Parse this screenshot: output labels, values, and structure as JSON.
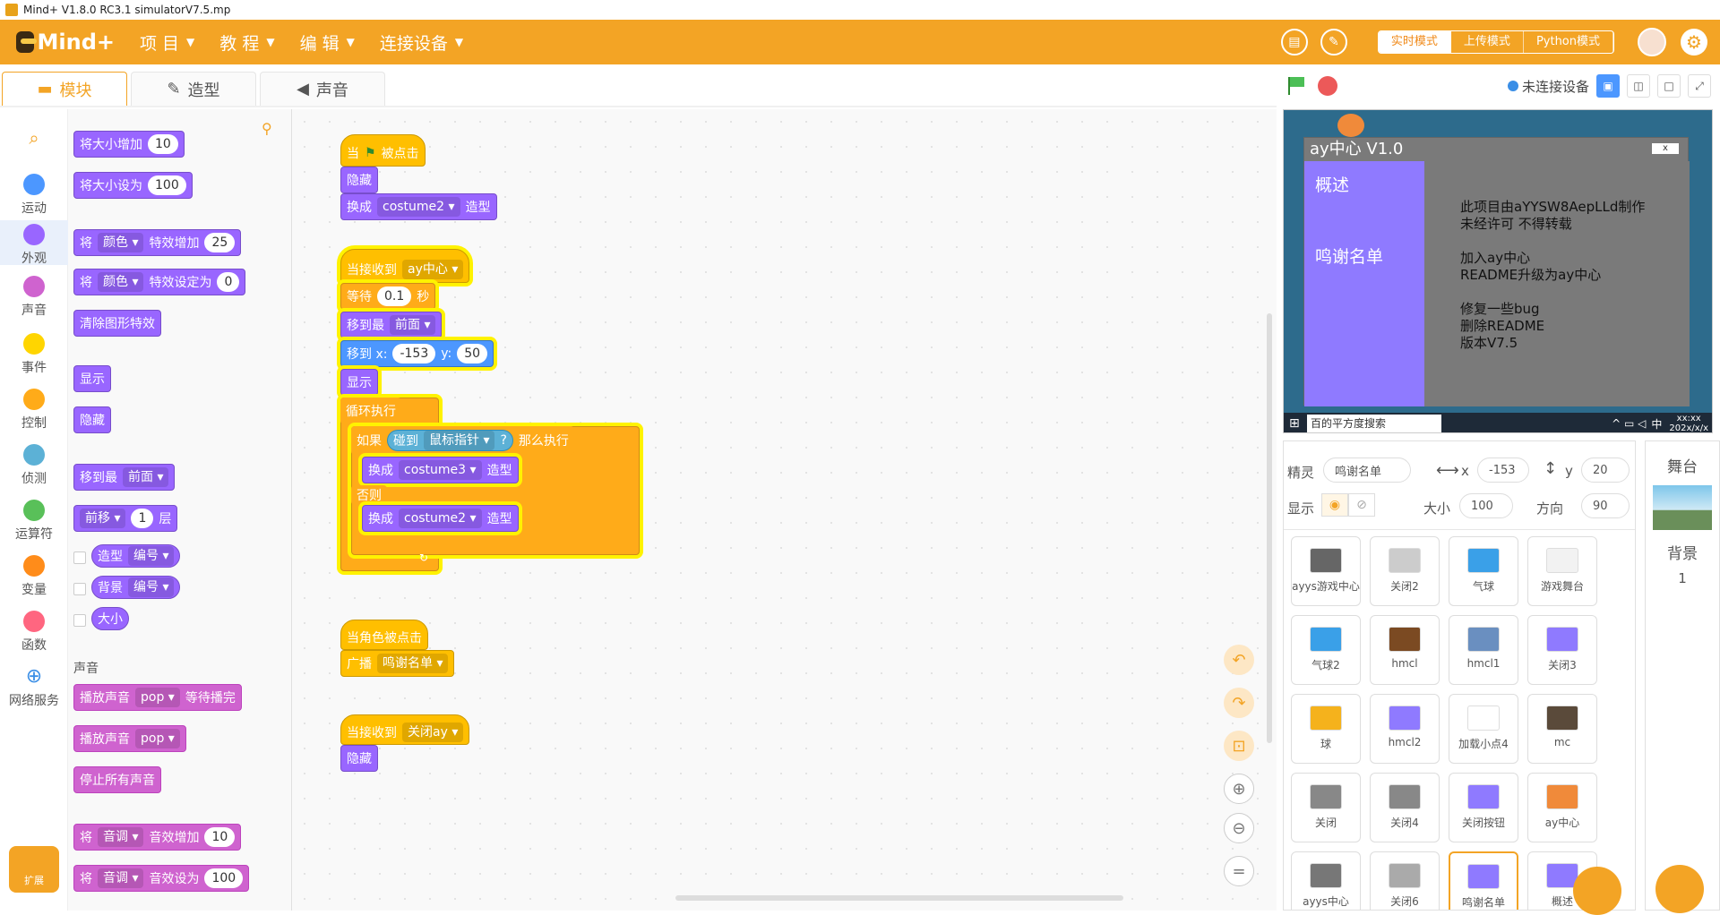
{
  "window": {
    "title": "Mind+ V1.8.0 RC3.1    simulatorV7.5.mp"
  },
  "menubar": {
    "logo": "Mind+",
    "items": [
      {
        "label": "项 目"
      },
      {
        "label": "教 程"
      },
      {
        "label": "编 辑"
      },
      {
        "label": "连接设备"
      }
    ],
    "modes": {
      "realtime": "实时模式",
      "upload": "上传模式",
      "python": "Python模式"
    }
  },
  "tabs": {
    "blocks": "模块",
    "costumes": "造型",
    "sounds": "声音"
  },
  "categories": [
    {
      "label": "运动",
      "color": "#4c97ff"
    },
    {
      "label": "外观",
      "color": "#9966ff"
    },
    {
      "label": "声音",
      "color": "#cf63cf"
    },
    {
      "label": "事件",
      "color": "#ffd500"
    },
    {
      "label": "控制",
      "color": "#ffab19"
    },
    {
      "label": "侦测",
      "color": "#5cb1d6"
    },
    {
      "label": "运算符",
      "color": "#59c059"
    },
    {
      "label": "变量",
      "color": "#ff8c1a"
    },
    {
      "label": "函数",
      "color": "#ff6680"
    },
    {
      "label": "网络服务",
      "color": "#3a8ee6"
    }
  ],
  "extend_label": "扩展",
  "palette": {
    "size_inc": {
      "text": "将大小增加",
      "val": "10"
    },
    "size_set": {
      "text": "将大小设为",
      "val": "100"
    },
    "effect_inc": {
      "pre": "将",
      "dd": "颜色",
      "text": "特效增加",
      "val": "25"
    },
    "effect_set": {
      "pre": "将",
      "dd": "颜色",
      "text": "特效设定为",
      "val": "0"
    },
    "clear_effects": "清除图形特效",
    "show": "显示",
    "hide": "隐藏",
    "goto_front": {
      "text": "移到最",
      "dd": "前面"
    },
    "forward": {
      "dd": "前移",
      "val": "1",
      "text": "层"
    },
    "costume_rep": {
      "text": "造型",
      "dd": "编号"
    },
    "backdrop_rep": {
      "text": "背景",
      "dd": "编号"
    },
    "size_rep": "大小",
    "sound_section": "声音",
    "play_until": {
      "text": "播放声音",
      "dd": "pop",
      "post": "等待播完"
    },
    "play": {
      "text": "播放声音",
      "dd": "pop"
    },
    "stop_all": "停止所有声音",
    "pitch_inc": {
      "pre": "将",
      "dd": "音调",
      "text": "音效增加",
      "val": "10"
    },
    "pitch_set": {
      "pre": "将",
      "dd": "音调",
      "text": "音效设为",
      "val": "100"
    }
  },
  "script1": {
    "hat": "当",
    "hat_post": "被点击",
    "hide": "隐藏",
    "switch": "换成",
    "costume": "costume2",
    "post": "造型"
  },
  "script2": {
    "hat": "当接收到",
    "msg": "ay中心",
    "wait": "等待",
    "wait_val": "0.1",
    "wait_unit": "秒",
    "goto_front": "移到最",
    "front_dd": "前面",
    "goto_xy": "移到 x:",
    "x": "-153",
    "y_label": "y:",
    "y": "50",
    "show": "显示",
    "forever": "循环执行",
    "if": "如果",
    "touching": "碰到",
    "target": "鼠标指针",
    "q": "?",
    "then": "那么执行",
    "switch1": "换成",
    "costume3": "costume3",
    "post1": "造型",
    "else": "否则",
    "switch2": "换成",
    "costume2": "costume2",
    "post2": "造型"
  },
  "script3": {
    "hat": "当角色被点击",
    "broadcast": "广播",
    "msg": "鸣谢名单"
  },
  "script4": {
    "hat": "当接收到",
    "msg": "关闭ay",
    "hide": "隐藏"
  },
  "stage_bar": {
    "connection": "未连接设备"
  },
  "stage": {
    "window_title": "ay中心 V1.0",
    "close": "x",
    "menu1": "概述",
    "menu2": "鸣谢名单",
    "lines": [
      "此项目由aYYSW8AepLLd制作",
      "未经许可 不得转载",
      "",
      "加入ay中心",
      "README升级为ay中心",
      "",
      "修复一些bug",
      "删除README",
      "版本V7.5"
    ],
    "taskbar_search": "百的平方度搜索",
    "taskbar_ime": "中",
    "taskbar_time": "xx:xx",
    "taskbar_date": "202x/x/x"
  },
  "sprite_info": {
    "sprite_label": "精灵",
    "sprite_name": "鸣谢名单",
    "x_label": "x",
    "x": "-153",
    "y_label": "y",
    "y": "20",
    "show_label": "显示",
    "size_label": "大小",
    "size": "100",
    "dir_label": "方向",
    "dir": "90"
  },
  "sprites": [
    {
      "name": "ayys游戏中心",
      "color": "#666666"
    },
    {
      "name": "关闭2",
      "color": "#cccccc"
    },
    {
      "name": "气球",
      "color": "#3aa0e8"
    },
    {
      "name": "游戏舞台",
      "color": "#f2f2f2"
    },
    {
      "name": "气球2",
      "color": "#3aa0e8"
    },
    {
      "name": "hmcl",
      "color": "#7b4a22"
    },
    {
      "name": "hmcl1",
      "color": "#6a8fc0"
    },
    {
      "name": "关闭3",
      "color": "#8f7aff"
    },
    {
      "name": "球",
      "color": "#f5b21c"
    },
    {
      "name": "hmcl2",
      "color": "#8f7aff"
    },
    {
      "name": "加载小点4",
      "color": "#ffffff"
    },
    {
      "name": "mc",
      "color": "#5a4a3a"
    },
    {
      "name": "关闭",
      "color": "#888888"
    },
    {
      "name": "关闭4",
      "color": "#888888"
    },
    {
      "name": "关闭按钮",
      "color": "#8f7aff"
    },
    {
      "name": "ay中心",
      "color": "#f08a3a"
    },
    {
      "name": "ayys中心",
      "color": "#777777"
    },
    {
      "name": "关闭6",
      "color": "#aaaaaa"
    },
    {
      "name": "鸣谢名单",
      "color": "#8f7aff"
    },
    {
      "name": "概述",
      "color": "#8f7aff"
    }
  ],
  "stage_panel": {
    "label": "舞台",
    "backdrop_label": "背景",
    "backdrop_count": "1"
  }
}
